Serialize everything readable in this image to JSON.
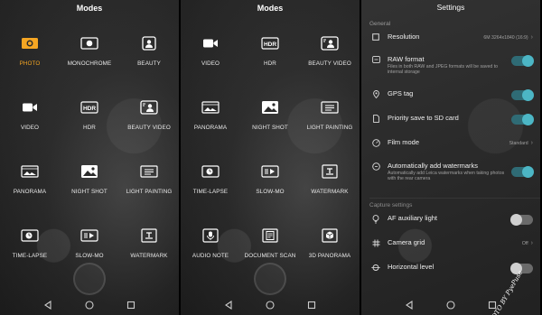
{
  "panel1": {
    "title": "Modes",
    "modes": [
      {
        "label": "PHOTO",
        "icon": "camera-icon",
        "active": true
      },
      {
        "label": "MONOCHROME",
        "icon": "monochrome-icon"
      },
      {
        "label": "BEAUTY",
        "icon": "beauty-icon"
      },
      {
        "label": "VIDEO",
        "icon": "video-icon"
      },
      {
        "label": "HDR",
        "icon": "hdr-icon"
      },
      {
        "label": "BEAUTY VIDEO",
        "icon": "beauty-video-icon"
      },
      {
        "label": "PANORAMA",
        "icon": "panorama-icon"
      },
      {
        "label": "NIGHT SHOT",
        "icon": "night-shot-icon"
      },
      {
        "label": "LIGHT PAINTING",
        "icon": "light-painting-icon"
      },
      {
        "label": "TIME-LAPSE",
        "icon": "time-lapse-icon"
      },
      {
        "label": "SLOW-MO",
        "icon": "slow-mo-icon"
      },
      {
        "label": "WATERMARK",
        "icon": "watermark-icon"
      }
    ]
  },
  "panel2": {
    "title": "Modes",
    "modes": [
      {
        "label": "VIDEO",
        "icon": "video-icon"
      },
      {
        "label": "HDR",
        "icon": "hdr-icon"
      },
      {
        "label": "BEAUTY VIDEO",
        "icon": "beauty-video-icon"
      },
      {
        "label": "PANORAMA",
        "icon": "panorama-icon"
      },
      {
        "label": "NIGHT SHOT",
        "icon": "night-shot-icon"
      },
      {
        "label": "LIGHT PAINTING",
        "icon": "light-painting-icon"
      },
      {
        "label": "TIME-LAPSE",
        "icon": "time-lapse-icon"
      },
      {
        "label": "SLOW-MO",
        "icon": "slow-mo-icon"
      },
      {
        "label": "WATERMARK",
        "icon": "watermark-icon"
      },
      {
        "label": "AUDIO NOTE",
        "icon": "audio-note-icon"
      },
      {
        "label": "DOCUMENT SCAN",
        "icon": "document-scan-icon"
      },
      {
        "label": "3D PANORAMA",
        "icon": "3d-panorama-icon"
      }
    ]
  },
  "settings": {
    "title": "Settings",
    "general_label": "General",
    "resolution": {
      "label": "Resolution",
      "value": "6M 3264x1840 (16:9)"
    },
    "raw": {
      "label": "RAW format",
      "desc": "Files in both RAW and JPEG formats will be saved to internal storage",
      "on": true
    },
    "gps": {
      "label": "GPS tag",
      "on": true
    },
    "priority_sd": {
      "label": "Priority save to SD card",
      "on": true
    },
    "film_mode": {
      "label": "Film mode",
      "value": "Standard"
    },
    "auto_watermark": {
      "label": "Automatically add watermarks",
      "desc": "Automatically add Leica watermarks when taking photos with the rear camera",
      "on": true
    },
    "capture_label": "Capture settings",
    "af_light": {
      "label": "AF auxiliary light",
      "on": false
    },
    "grid": {
      "label": "Camera grid",
      "value": "Off"
    },
    "level": {
      "label": "Horizontal level",
      "on": false
    }
  },
  "stamp": "PHOTO BY PyePuse",
  "colors": {
    "accent_active": "#f5a623",
    "toggle_on": "#4cb6c5"
  }
}
